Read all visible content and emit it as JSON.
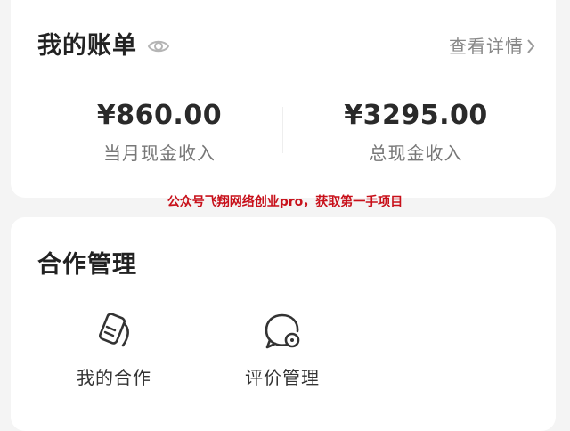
{
  "bill": {
    "title": "我的账单",
    "visibility_icon": "eye-icon",
    "detail_link": "查看详情",
    "detail_icon": "chevron-right-icon",
    "stats": {
      "month_income_value": "¥860.00",
      "month_income_label": "当月现金收入",
      "total_income_value": "¥3295.00",
      "total_income_label": "总现金收入"
    }
  },
  "watermark": "公众号飞翔网络创业pro，获取第一手项目",
  "cooperation": {
    "title": "合作管理",
    "items": [
      {
        "label": "我的合作",
        "icon": "document-stack-icon"
      },
      {
        "label": "评价管理",
        "icon": "chat-review-icon"
      }
    ]
  },
  "colors": {
    "background": "#f4f4f4",
    "card": "#ffffff",
    "primary_text": "#222222",
    "secondary_text": "#888888",
    "watermark": "#c8101a"
  }
}
